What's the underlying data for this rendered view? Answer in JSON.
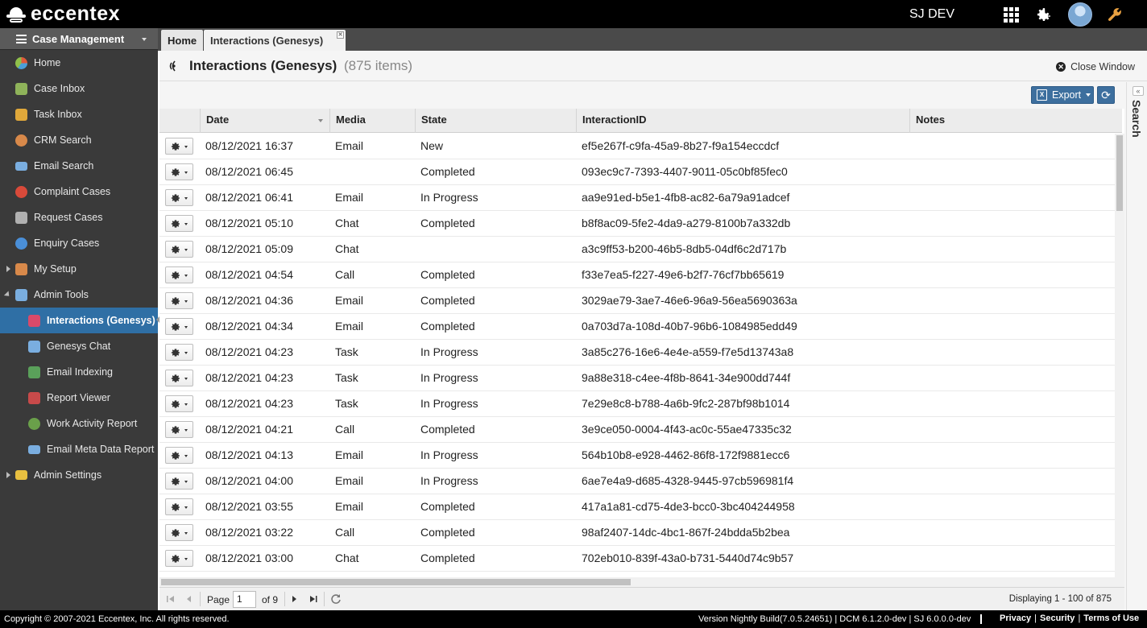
{
  "app": {
    "logo_text": "eccentex",
    "user_name": "SJ DEV"
  },
  "sidebar": {
    "header": "Case Management",
    "items": [
      {
        "label": "Home",
        "icon": "home-chart-icon",
        "color": "#4a9fd8"
      },
      {
        "label": "Case Inbox",
        "icon": "case-inbox-icon",
        "color": "#8fb35a"
      },
      {
        "label": "Task Inbox",
        "icon": "task-inbox-icon",
        "color": "#e0a83a"
      },
      {
        "label": "CRM Search",
        "icon": "crm-search-icon",
        "color": "#d8894a"
      },
      {
        "label": "Email Search",
        "icon": "email-search-icon",
        "color": "#7aaee0"
      },
      {
        "label": "Complaint Cases",
        "icon": "complaint-icon",
        "color": "#d94a3a"
      },
      {
        "label": "Request Cases",
        "icon": "request-icon",
        "color": "#b0b0b0"
      },
      {
        "label": "Enquiry Cases",
        "icon": "enquiry-icon",
        "color": "#4a8fd8"
      },
      {
        "label": "My Setup",
        "icon": "my-setup-icon",
        "color": "#d8894a"
      },
      {
        "label": "Admin Tools",
        "icon": "admin-tools-icon",
        "color": "#7aaee0"
      },
      {
        "label": "Interactions (Genesys)",
        "icon": "interactions-icon",
        "color": "#d94a6a"
      },
      {
        "label": "Genesys Chat",
        "icon": "genesys-chat-icon",
        "color": "#7aaee0"
      },
      {
        "label": "Email Indexing",
        "icon": "email-indexing-icon",
        "color": "#5aa05a"
      },
      {
        "label": "Report Viewer",
        "icon": "report-viewer-icon",
        "color": "#c84a4a"
      },
      {
        "label": "Work Activity Report",
        "icon": "work-activity-icon",
        "color": "#6aa04a"
      },
      {
        "label": "Email Meta Data Report",
        "icon": "email-meta-icon",
        "color": "#7aaee0"
      },
      {
        "label": "Admin Settings",
        "icon": "folder-icon",
        "color": "#e8c040"
      }
    ]
  },
  "tabs": {
    "home": "Home",
    "active": "Interactions (Genesys)"
  },
  "page": {
    "title": "Interactions (Genesys)",
    "count": "(875 items)",
    "close_label": "Close Window",
    "export_label": "Export",
    "search_label": "Search"
  },
  "table": {
    "columns": [
      "Date",
      "Media",
      "State",
      "InteractionID",
      "Notes"
    ],
    "rows": [
      [
        "08/12/2021 16:37",
        "Email",
        "New",
        "ef5e267f-c9fa-45a9-8b27-f9a154eccdcf"
      ],
      [
        "08/12/2021 06:45",
        "",
        "Completed",
        "093ec9c7-7393-4407-9011-05c0bf85fec0"
      ],
      [
        "08/12/2021 06:41",
        "Email",
        "In Progress",
        "aa9e91ed-b5e1-4fb8-ac82-6a79a91adcef"
      ],
      [
        "08/12/2021 05:10",
        "Chat",
        "Completed",
        "b8f8ac09-5fe2-4da9-a279-8100b7a332db"
      ],
      [
        "08/12/2021 05:09",
        "Chat",
        "",
        "a3c9ff53-b200-46b5-8db5-04df6c2d717b"
      ],
      [
        "08/12/2021 04:54",
        "Call",
        "Completed",
        "f33e7ea5-f227-49e6-b2f7-76cf7bb65619"
      ],
      [
        "08/12/2021 04:36",
        "Email",
        "Completed",
        "3029ae79-3ae7-46e6-96a9-56ea5690363a"
      ],
      [
        "08/12/2021 04:34",
        "Email",
        "Completed",
        "0a703d7a-108d-40b7-96b6-1084985edd49"
      ],
      [
        "08/12/2021 04:23",
        "Task",
        "In Progress",
        "3a85c276-16e6-4e4e-a559-f7e5d13743a8"
      ],
      [
        "08/12/2021 04:23",
        "Task",
        "In Progress",
        "9a88e318-c4ee-4f8b-8641-34e900dd744f"
      ],
      [
        "08/12/2021 04:23",
        "Task",
        "In Progress",
        "7e29e8c8-b788-4a6b-9fc2-287bf98b1014"
      ],
      [
        "08/12/2021 04:21",
        "Call",
        "Completed",
        "3e9ce050-0004-4f43-ac0c-55ae47335c32"
      ],
      [
        "08/12/2021 04:13",
        "Email",
        "In Progress",
        "564b10b8-e928-4462-86f8-172f9881ecc6"
      ],
      [
        "08/12/2021 04:00",
        "Email",
        "In Progress",
        "6ae7e4a9-d685-4328-9445-97cb596981f4"
      ],
      [
        "08/12/2021 03:55",
        "Email",
        "Completed",
        "417a1a81-cd75-4de3-bcc0-3bc404244958"
      ],
      [
        "08/12/2021 03:22",
        "Call",
        "Completed",
        "98af2407-14dc-4bc1-867f-24bdda5b2bea"
      ],
      [
        "08/12/2021 03:00",
        "Chat",
        "Completed",
        "702eb010-839f-43a0-b731-5440d74c9b57"
      ]
    ]
  },
  "pager": {
    "page_label": "Page",
    "page_value": "1",
    "of_label": "of 9",
    "displaying": "Displaying 1 - 100 of 875"
  },
  "footer": {
    "copyright": "Copyright © 2007-2021 Eccentex, Inc. All rights reserved.",
    "version": "Version   Nightly Build(7.0.5.24651) | DCM 6.1.2.0-dev | SJ 6.0.0.0-dev",
    "privacy": "Privacy",
    "security": "Security",
    "terms": "Terms of Use"
  },
  "colors": {
    "accent": "#2f6fa5",
    "button": "#3d6f9e",
    "sidebar_bg": "#3a3a3a",
    "topbar_bg": "#000000"
  }
}
